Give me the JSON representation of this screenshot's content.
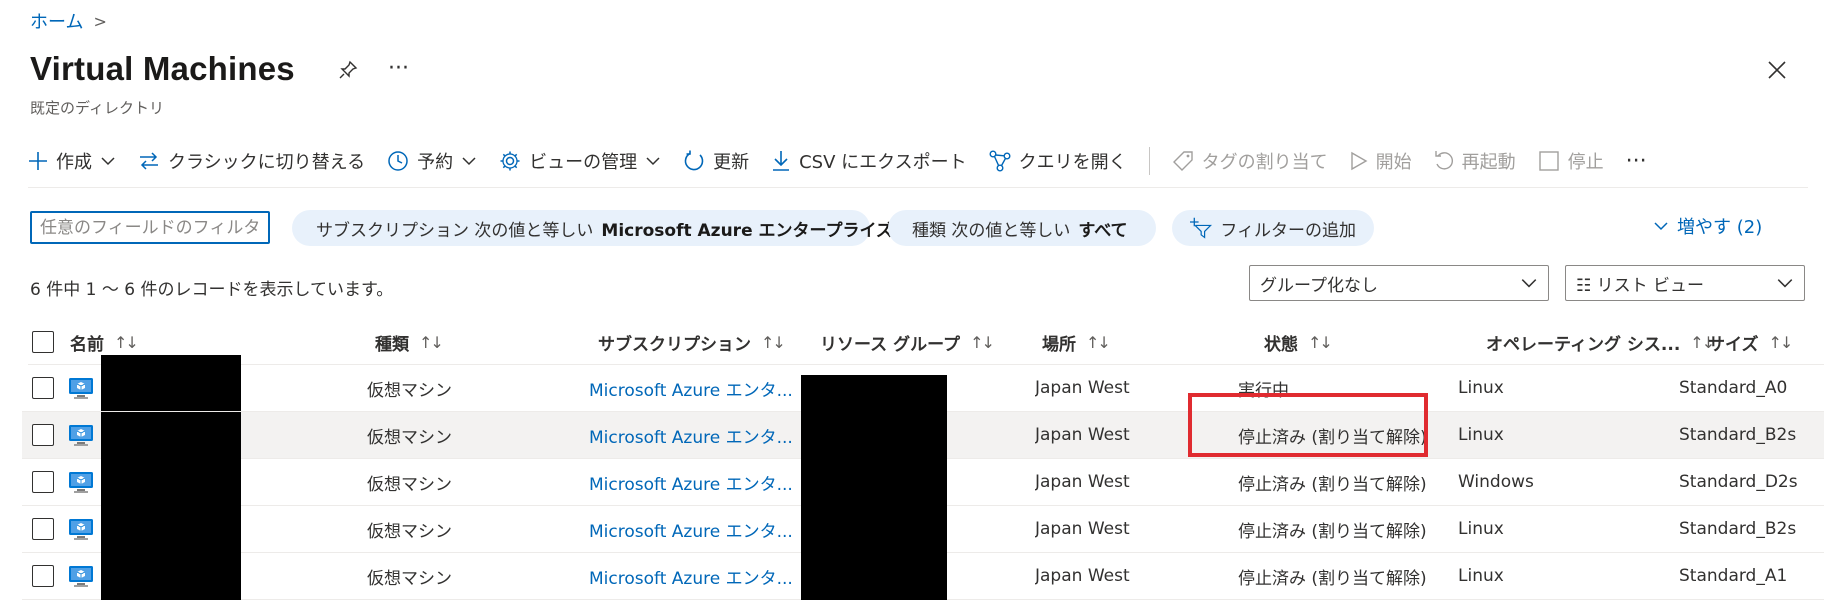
{
  "breadcrumb": {
    "home": "ホーム"
  },
  "header": {
    "title": "Virtual Machines",
    "subtitle": "既定のディレクトリ"
  },
  "toolbar": {
    "create": "作成",
    "switch_classic": "クラシックに切り替える",
    "reservation": "予約",
    "manage_view": "ビューの管理",
    "refresh": "更新",
    "export_csv": "CSV にエクスポート",
    "open_query": "クエリを開く",
    "assign_tags": "タグの割り当て",
    "start": "開始",
    "restart": "再起動",
    "stop": "停止"
  },
  "filters": {
    "search_placeholder": "任意のフィールドのフィルター...",
    "subscription_label": "サブスクリプション 次の値と等しい",
    "subscription_value": "Microsoft Azure エンタープライズ",
    "type_label": "種類 次の値と等しい",
    "type_value": "すべて",
    "add_filter": "フィルターの追加",
    "more": "増やす (2)"
  },
  "list": {
    "record_count": "6 件中 1 ～ 6 件のレコードを表示しています。",
    "group_by": "グループ化なし",
    "view_mode": "☷ リスト ビュー"
  },
  "table": {
    "columns": {
      "name": "名前",
      "type": "種類",
      "subscription": "サブスクリプション",
      "resource_group": "リソース グループ",
      "location": "場所",
      "status": "状態",
      "os": "オペレーティング シス...",
      "size": "サイズ"
    },
    "rows": [
      {
        "type": "仮想マシン",
        "subscription": "Microsoft Azure エンタ...",
        "location": "Japan West",
        "status": "実行中",
        "os": "Linux",
        "size": "Standard_A0"
      },
      {
        "type": "仮想マシン",
        "subscription": "Microsoft Azure エンタ...",
        "location": "Japan West",
        "status": "停止済み (割り当て解除)",
        "os": "Linux",
        "size": "Standard_B2s"
      },
      {
        "type": "仮想マシン",
        "subscription": "Microsoft Azure エンタ...",
        "location": "Japan West",
        "status": "停止済み (割り当て解除)",
        "os": "Windows",
        "size": "Standard_D2s"
      },
      {
        "type": "仮想マシン",
        "subscription": "Microsoft Azure エンタ...",
        "location": "Japan West",
        "status": "停止済み (割り当て解除)",
        "os": "Linux",
        "size": "Standard_B2s"
      },
      {
        "type": "仮想マシン",
        "subscription": "Microsoft Azure エンタ...",
        "location": "Japan West",
        "status": "停止済み (割り当て解除)",
        "os": "Linux",
        "size": "Standard_A1"
      }
    ]
  },
  "colors": {
    "accent": "#0067b8",
    "highlight": "#e02b30",
    "pill_bg": "#e8f1fb"
  }
}
